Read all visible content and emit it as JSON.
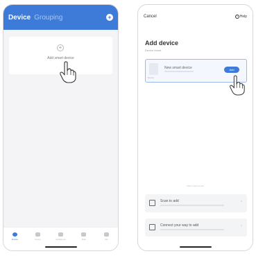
{
  "left": {
    "header": {
      "tab_device": "Device",
      "tab_grouping": "Grouping",
      "add_icon": "+"
    },
    "add_card": {
      "plus_icon": "+",
      "label": "Add smart device"
    },
    "bottom_nav": [
      {
        "label": "Device",
        "active": true
      },
      {
        "label": "Scene",
        "active": false
      },
      {
        "label": "Intelligence",
        "active": false
      },
      {
        "label": "Mall",
        "active": false
      },
      {
        "label": "Me",
        "active": false
      }
    ]
  },
  "right": {
    "top": {
      "cancel": "Cancel",
      "help_icon": "?",
      "help": "Help"
    },
    "title": "Add device",
    "subtitle": "Device found",
    "device_card": {
      "thumb_label": "Device",
      "name": "New smart device",
      "add_button": "Add"
    },
    "divider_note": "Other ways to add",
    "options": [
      {
        "title": "Scan to add",
        "chevron": "›"
      },
      {
        "title": "Connect your way to add",
        "chevron": "›"
      }
    ]
  },
  "colors": {
    "accent": "#3e7bd8",
    "header_bg": "#3e7bd8",
    "card_border": "#9bb9e8"
  }
}
